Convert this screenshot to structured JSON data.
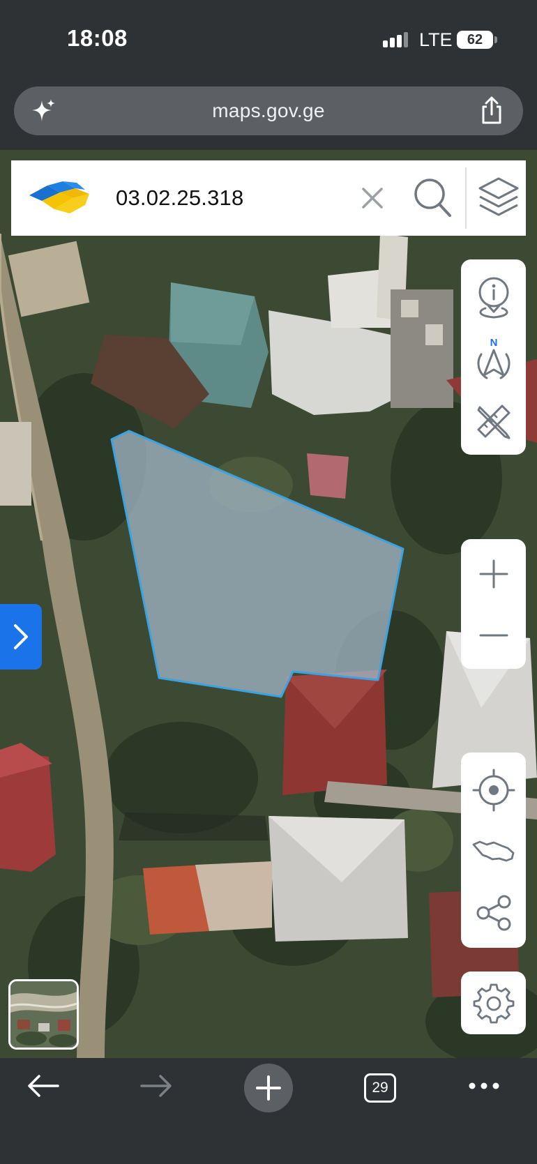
{
  "status": {
    "time": "18:08",
    "network": "LTE",
    "battery": "62",
    "icons": [
      "signal-bars-icon",
      "battery-icon"
    ]
  },
  "browser": {
    "url": "maps.gov.ge",
    "icons": [
      "sparkle-icon",
      "share-icon"
    ],
    "toolbar": {
      "tabs_count": "29",
      "icons": [
        "back-arrow-icon",
        "forward-arrow-icon",
        "new-tab-plus-icon",
        "tabs-icon",
        "more-icon"
      ]
    }
  },
  "search": {
    "value": "03.02.25.318",
    "icons": [
      "napr-logo-icon",
      "clear-icon",
      "search-icon",
      "layers-icon"
    ]
  },
  "map_controls": {
    "tools_panel": [
      "info-location-icon",
      "north-compass-icon",
      "measure-ruler-pencil-icon"
    ],
    "zoom_panel": [
      "zoom-in-icon",
      "zoom-out-icon"
    ],
    "location_panel": [
      "my-location-icon",
      "georgia-map-icon",
      "share-icon"
    ],
    "settings_panel": [
      "settings-gear-icon"
    ],
    "drawer_toggle": "chevron-right-icon",
    "basemap_switcher": "basemap-thumbnail"
  },
  "map": {
    "view": "satellite",
    "highlighted_parcel": "03.02.25.318",
    "colors": {
      "parcel_fill": "#9fb3c3",
      "parcel_stroke": "#3aa3e0",
      "accent": "#1a73e8"
    }
  }
}
